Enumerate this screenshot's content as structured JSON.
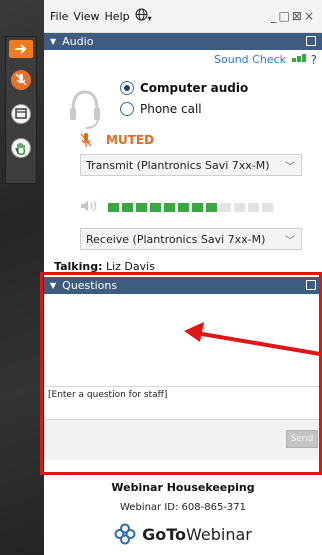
{
  "menubar": {
    "file": "File",
    "view": "View",
    "help": "Help",
    "window_controls": "_□⊠×"
  },
  "audio": {
    "header": "Audio",
    "sound_check": "Sound Check",
    "help_q": "?",
    "computer_audio": "Computer audio",
    "phone_call": "Phone call",
    "selected_mode": "Computer audio",
    "muted": "MUTED",
    "transmit_device": "Transmit (Plantronics Savi 7xx-M)",
    "receive_device": "Receive (Plantronics Savi 7xx-M)",
    "input_level_active_bars": 8,
    "input_level_total_bars": 12
  },
  "talking": {
    "label": "Talking:",
    "name": "Liz Davis"
  },
  "questions": {
    "header": "Questions",
    "input_placeholder": "[Enter a question for staff]",
    "send_label": "Send"
  },
  "footer": {
    "title": "Webinar Housekeeping",
    "webinar_id": "Webinar ID: 608-865-371",
    "logo_goto": "GoTo",
    "logo_webinar": "Webinar"
  },
  "colors": {
    "header_blue": "#3e5c80",
    "accent_orange": "#e8712a",
    "level_green": "#3aa841",
    "annotation_red": "#e01515"
  },
  "icons": [
    "expand-arrow-icon",
    "microphone-muted-icon",
    "screen-icon",
    "raise-hand-icon",
    "globe-icon",
    "headset-icon",
    "speaker-icon",
    "signal-bars-icon",
    "popout-icon"
  ]
}
